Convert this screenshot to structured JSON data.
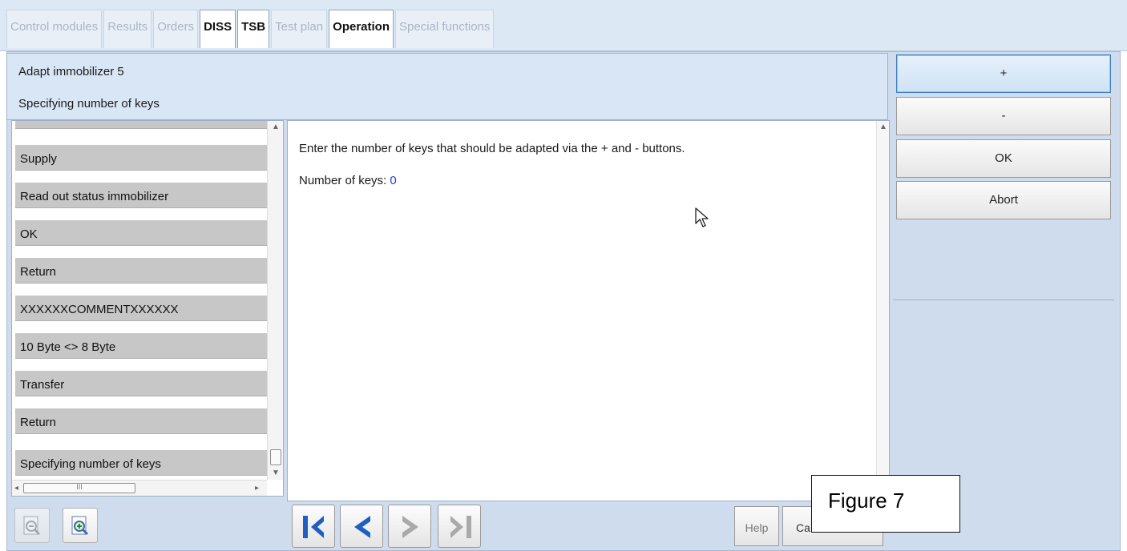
{
  "tabs": [
    {
      "label": "Control modules",
      "state": "disabled"
    },
    {
      "label": "Results",
      "state": "disabled"
    },
    {
      "label": "Orders",
      "state": "disabled"
    },
    {
      "label": "DISS",
      "state": "enabled"
    },
    {
      "label": "TSB",
      "state": "enabled"
    },
    {
      "label": "Test plan",
      "state": "disabled"
    },
    {
      "label": "Operation",
      "state": "active"
    },
    {
      "label": "Special functions",
      "state": "disabled"
    }
  ],
  "header": {
    "title": "Adapt immobilizer 5",
    "subtitle": "Specifying number of keys"
  },
  "steps": {
    "partial_label": "Return",
    "items": [
      "Supply",
      "Read out status immobilizer",
      "OK",
      "Return",
      "XXXXXXCOMMENTXXXXXX",
      "10 Byte <> 8 Byte",
      "Transfer",
      "Return",
      "Specifying number of keys"
    ],
    "hscroll_grip": "III"
  },
  "content": {
    "instruction": "Enter the number of keys that should be adapted via the + and - buttons.",
    "count_label": "Number of keys:",
    "count_value": "0"
  },
  "actions": {
    "plus": "+",
    "minus": "-",
    "ok": "OK",
    "abort": "Abort"
  },
  "footer": {
    "help": "Help",
    "cancel_partial": "Ca",
    "figure_label": "Figure 7"
  },
  "icons": [
    "zoom-out-icon",
    "zoom-in-icon",
    "first-page-icon",
    "previous-page-icon",
    "next-page-icon",
    "last-page-icon",
    "mouse-cursor-icon"
  ],
  "colors": {
    "accent": "#1e3fd0",
    "nav_arrow": "#1f5fc2",
    "nav_arrow_disabled": "#a9a9a9"
  }
}
